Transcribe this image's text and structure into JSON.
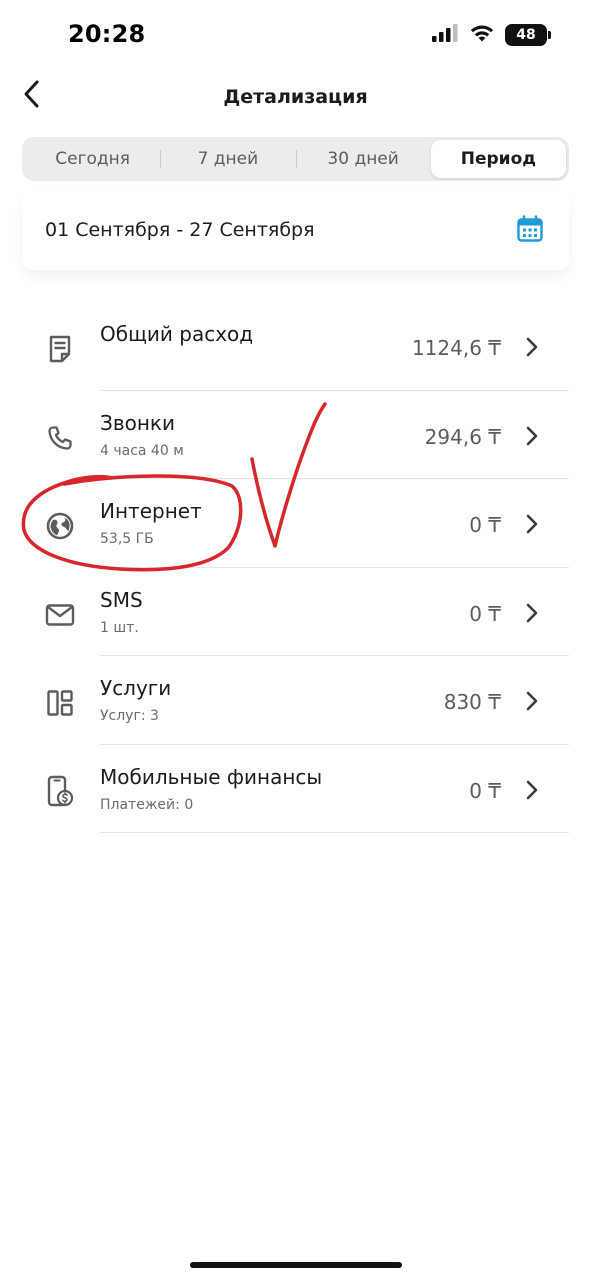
{
  "status_bar": {
    "time": "20:28",
    "battery": "48",
    "icons": [
      "signal-icon",
      "wifi-icon",
      "battery-icon"
    ]
  },
  "header": {
    "title": "Детализация",
    "back_icon": "chevron-left-icon"
  },
  "tabs": [
    {
      "label": "Сегодня",
      "active": false
    },
    {
      "label": "7 дней",
      "active": false
    },
    {
      "label": "30 дней",
      "active": false
    },
    {
      "label": "Период",
      "active": true
    }
  ],
  "date_range": {
    "text": "01 Сентября - 27 Сентября",
    "icon": "calendar-icon"
  },
  "items": [
    {
      "title": "Общий расход",
      "subtitle": "",
      "value": "1124,6 ₸",
      "icon": "receipt-icon"
    },
    {
      "title": "Звонки",
      "subtitle": "4 часа 40 м",
      "value": "294,6 ₸",
      "icon": "phone-icon"
    },
    {
      "title": "Интернет",
      "subtitle": "53,5 ГБ",
      "value": "0 ₸",
      "icon": "globe-icon"
    },
    {
      "title": "SMS",
      "subtitle": "1 шт.",
      "value": "0 ₸",
      "icon": "envelope-icon"
    },
    {
      "title": "Услуги",
      "subtitle": "Услуг: 3",
      "value": "830 ₸",
      "icon": "services-grid-icon"
    },
    {
      "title": "Мобильные финансы",
      "subtitle": "Платежей: 0",
      "value": "0 ₸",
      "icon": "mobile-payment-icon"
    }
  ],
  "colors": {
    "accent": "#1e9bd7",
    "annotation": "#d7262c",
    "segment_bg": "#ececee",
    "text_primary": "#1c1c1e",
    "text_secondary": "#6b6b70"
  }
}
